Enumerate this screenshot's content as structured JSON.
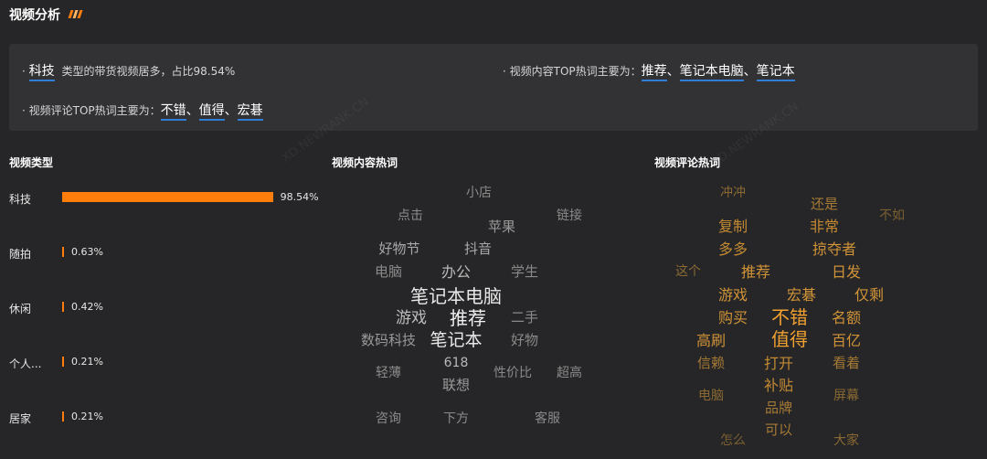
{
  "page": {
    "title": "视频分析",
    "accent_color": "#ff7d0b",
    "highlight_underline_color": "#2f7dd6"
  },
  "summary": {
    "type_line": {
      "bullet": "·",
      "keyword": "科技",
      "text": "类型的带货视频居多，占比98.54%"
    },
    "content_line": {
      "prefix": "· 视频内容TOP热词主要为：",
      "words": [
        "推荐",
        "笔记本电脑",
        "笔记本"
      ],
      "separator": "、"
    },
    "comment_line": {
      "prefix": "· 视频评论TOP热词主要为：",
      "words": [
        "不错",
        "值得",
        "宏碁"
      ],
      "separator": "、"
    }
  },
  "video_types": {
    "title": "视频类型",
    "bar_color": "#ff7d0b",
    "items": [
      {
        "label": "科技",
        "percent": 98.54,
        "value_text": "98.54%"
      },
      {
        "label": "随拍",
        "percent": 0.63,
        "value_text": "0.63%"
      },
      {
        "label": "休闲",
        "percent": 0.42,
        "value_text": "0.42%"
      },
      {
        "label": "个人...",
        "percent": 0.21,
        "value_text": "0.21%"
      },
      {
        "label": "居家",
        "percent": 0.21,
        "value_text": "0.21%"
      }
    ]
  },
  "content_cloud": {
    "title": "视频内容热词",
    "words": [
      "小店",
      "点击",
      "链接",
      "苹果",
      "好物节",
      "抖音",
      "电脑",
      "办公",
      "学生",
      "笔记本电脑",
      "游戏",
      "推荐",
      "二手",
      "数码科技",
      "笔记本",
      "好物",
      "618",
      "轻薄",
      "性价比",
      "超高",
      "联想",
      "咨询",
      "下方",
      "客服"
    ]
  },
  "comment_cloud": {
    "title": "视频评论热词",
    "words": [
      "冲冲",
      "还是",
      "不如",
      "复制",
      "非常",
      "多多",
      "掠夺者",
      "这个",
      "推荐",
      "日发",
      "游戏",
      "宏碁",
      "仅剩",
      "购买",
      "不错",
      "名额",
      "高刷",
      "值得",
      "百亿",
      "信赖",
      "打开",
      "看着",
      "电脑",
      "补贴",
      "屏幕",
      "品牌",
      "可以",
      "怎么",
      "大家"
    ]
  }
}
